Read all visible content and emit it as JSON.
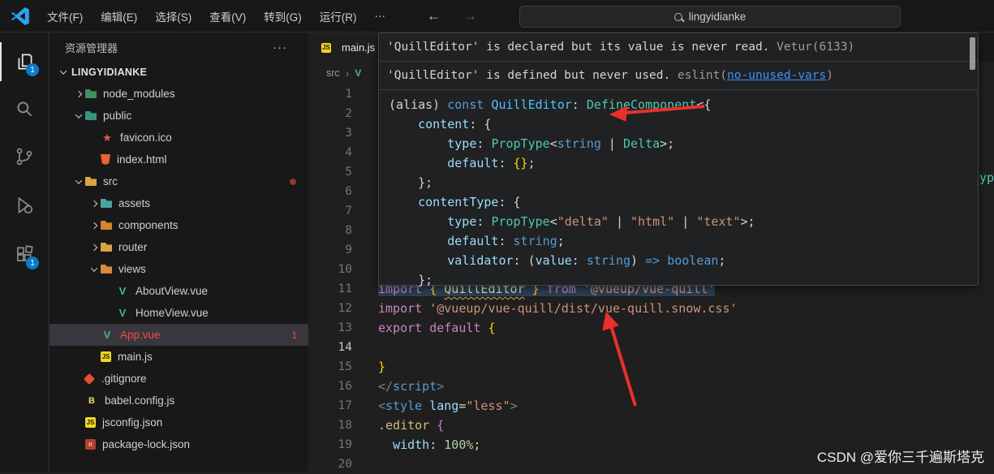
{
  "titlebar": {
    "menus": [
      "文件(F)",
      "编辑(E)",
      "选择(S)",
      "查看(V)",
      "转到(G)",
      "运行(R)"
    ],
    "more": "···",
    "nav_back": "←",
    "nav_forward": "→",
    "search_value": "lingyidianke"
  },
  "activity_bar": {
    "explorer_badge": "1",
    "extensions_badge": "1"
  },
  "sidebar": {
    "header": "资源管理器",
    "items": [
      {
        "label": "LINGYIDIANKE",
        "level": 0,
        "arrow": "v",
        "bold": true
      },
      {
        "label": "node_modules",
        "level": 1,
        "arrow": ">",
        "icon": "folder-nm"
      },
      {
        "label": "public",
        "level": 1,
        "arrow": "v",
        "icon": "folder-public"
      },
      {
        "label": "favicon.ico",
        "level": 2,
        "icon": "favicon"
      },
      {
        "label": "index.html",
        "level": 2,
        "icon": "html"
      },
      {
        "label": "src",
        "level": 1,
        "arrow": "v",
        "icon": "folder-src",
        "dot": true
      },
      {
        "label": "assets",
        "level": 2,
        "arrow": ">",
        "icon": "folder-assets"
      },
      {
        "label": "components",
        "level": 2,
        "arrow": ">",
        "icon": "folder-components"
      },
      {
        "label": "router",
        "level": 2,
        "arrow": ">",
        "icon": "folder-router"
      },
      {
        "label": "views",
        "level": 2,
        "arrow": "v",
        "icon": "folder-views"
      },
      {
        "label": "AboutView.vue",
        "level": 3,
        "icon": "vue"
      },
      {
        "label": "HomeView.vue",
        "level": 3,
        "icon": "vue"
      },
      {
        "label": "App.vue",
        "level": 2,
        "icon": "vue",
        "selected": true,
        "error": true,
        "badge": "1"
      },
      {
        "label": "main.js",
        "level": 2,
        "icon": "js"
      },
      {
        "label": ".gitignore",
        "level": 1,
        "icon": "git"
      },
      {
        "label": "babel.config.js",
        "level": 1,
        "icon": "babel"
      },
      {
        "label": "jsconfig.json",
        "level": 1,
        "icon": "js"
      },
      {
        "label": "package-lock.json",
        "level": 1,
        "icon": "npm"
      }
    ]
  },
  "icons": {
    "js": "JS",
    "vue": "V",
    "babel": "B",
    "npm": "n",
    "favicon": "★"
  },
  "editor": {
    "tab_label": "main.js",
    "breadcrumb_root": "src",
    "breadcrumb_sep": "›",
    "lines": [
      {
        "n": 1
      },
      {
        "n": 2
      },
      {
        "n": 3
      },
      {
        "n": 4
      },
      {
        "n": 5
      },
      {
        "n": 6
      },
      {
        "n": 7
      },
      {
        "n": 8
      },
      {
        "n": 9
      },
      {
        "n": 10
      },
      {
        "n": 11,
        "bg": true,
        "tokens": [
          {
            "t": "import",
            "c": "kw"
          },
          {
            "t": " ",
            "c": "p"
          },
          {
            "t": "{ ",
            "c": "y"
          },
          {
            "t": "QuillEditor",
            "c": "warn"
          },
          {
            "t": " }",
            "c": "y"
          },
          {
            "t": " ",
            "c": "p"
          },
          {
            "t": "from",
            "c": "kw"
          },
          {
            "t": " ",
            "c": "p"
          },
          {
            "t": "'@vueup/vue-quill'",
            "c": "str"
          }
        ]
      },
      {
        "n": 12,
        "tokens": [
          {
            "t": "import",
            "c": "kw"
          },
          {
            "t": " ",
            "c": "p"
          },
          {
            "t": "'@vueup/vue-quill/dist/vue-quill.snow.css'",
            "c": "str"
          }
        ]
      },
      {
        "n": 13,
        "tokens": [
          {
            "t": "export",
            "c": "kw"
          },
          {
            "t": " ",
            "c": "p"
          },
          {
            "t": "default",
            "c": "kw"
          },
          {
            "t": " ",
            "c": "p"
          },
          {
            "t": "{",
            "c": "y"
          }
        ]
      },
      {
        "n": 14,
        "active": true
      },
      {
        "n": 15,
        "tokens": [
          {
            "t": "}",
            "c": "y"
          }
        ]
      },
      {
        "n": 16,
        "tokens": [
          {
            "t": "</",
            "c": "gray"
          },
          {
            "t": "script",
            "c": "blue"
          },
          {
            "t": ">",
            "c": "gray"
          }
        ]
      },
      {
        "n": 17,
        "tokens": [
          {
            "t": "<",
            "c": "gray"
          },
          {
            "t": "style",
            "c": "blue"
          },
          {
            "t": " ",
            "c": "p"
          },
          {
            "t": "lang",
            "c": "var"
          },
          {
            "t": "=",
            "c": "p"
          },
          {
            "t": "\"less\"",
            "c": "str"
          },
          {
            "t": ">",
            "c": "gray"
          }
        ]
      },
      {
        "n": 18,
        "tokens": [
          {
            "t": ".editor",
            "c": "css"
          },
          {
            "t": " ",
            "c": "p"
          },
          {
            "t": "{",
            "c": "m"
          }
        ]
      },
      {
        "n": 19,
        "tokens": [
          {
            "t": "  ",
            "c": "p"
          },
          {
            "t": "width",
            "c": "var"
          },
          {
            "t": ": ",
            "c": "p"
          },
          {
            "t": "100%",
            "c": "num"
          },
          {
            "t": ";",
            "c": "p"
          }
        ]
      },
      {
        "n": 20
      }
    ]
  },
  "hover": {
    "messages": [
      {
        "parts": [
          {
            "t": "'QuillEditor' is declared but its value is never read. ",
            "c": "msg"
          },
          {
            "t": "Vetur(6133)",
            "c": "dim"
          }
        ]
      },
      {
        "parts": [
          {
            "t": "'QuillEditor' is defined but never used. ",
            "c": "msg"
          },
          {
            "t": "eslint(",
            "c": "dim"
          },
          {
            "t": "no-unused-vars",
            "c": "link"
          },
          {
            "t": ")",
            "c": "dim"
          }
        ]
      }
    ],
    "code": [
      {
        "tokens": [
          {
            "t": "(alias) ",
            "c": "p"
          },
          {
            "t": "const ",
            "c": "blue"
          },
          {
            "t": "QuillEditor",
            "c": "varb"
          },
          {
            "t": ": ",
            "c": "p"
          },
          {
            "t": "DefineComponent",
            "c": "type"
          },
          {
            "t": "<{",
            "c": "p"
          }
        ]
      },
      {
        "tokens": [
          {
            "t": "    ",
            "c": "p"
          },
          {
            "t": "content",
            "c": "var"
          },
          {
            "t": ": {",
            "c": "p"
          }
        ]
      },
      {
        "tokens": [
          {
            "t": "        ",
            "c": "p"
          },
          {
            "t": "type",
            "c": "var"
          },
          {
            "t": ": ",
            "c": "p"
          },
          {
            "t": "PropType",
            "c": "type"
          },
          {
            "t": "<",
            "c": "p"
          },
          {
            "t": "string",
            "c": "blue"
          },
          {
            "t": " | ",
            "c": "p"
          },
          {
            "t": "Delta",
            "c": "type"
          },
          {
            "t": ">;",
            "c": "p"
          }
        ]
      },
      {
        "tokens": [
          {
            "t": "        ",
            "c": "p"
          },
          {
            "t": "default",
            "c": "var"
          },
          {
            "t": ": ",
            "c": "p"
          },
          {
            "t": "{}",
            "c": "y"
          },
          {
            "t": ";",
            "c": "p"
          }
        ]
      },
      {
        "tokens": [
          {
            "t": "    };",
            "c": "p"
          }
        ]
      },
      {
        "tokens": [
          {
            "t": "    ",
            "c": "p"
          },
          {
            "t": "contentType",
            "c": "var"
          },
          {
            "t": ": {",
            "c": "p"
          }
        ]
      },
      {
        "tokens": [
          {
            "t": "        ",
            "c": "p"
          },
          {
            "t": "type",
            "c": "var"
          },
          {
            "t": ": ",
            "c": "p"
          },
          {
            "t": "PropType",
            "c": "type"
          },
          {
            "t": "<",
            "c": "p"
          },
          {
            "t": "\"delta\"",
            "c": "str"
          },
          {
            "t": " | ",
            "c": "p"
          },
          {
            "t": "\"html\"",
            "c": "str"
          },
          {
            "t": " | ",
            "c": "p"
          },
          {
            "t": "\"text\"",
            "c": "str"
          },
          {
            "t": ">;",
            "c": "p"
          }
        ]
      },
      {
        "tokens": [
          {
            "t": "        ",
            "c": "p"
          },
          {
            "t": "default",
            "c": "var"
          },
          {
            "t": ": ",
            "c": "p"
          },
          {
            "t": "string",
            "c": "blue"
          },
          {
            "t": ";",
            "c": "p"
          }
        ]
      },
      {
        "tokens": [
          {
            "t": "        ",
            "c": "p"
          },
          {
            "t": "validator",
            "c": "var"
          },
          {
            "t": ": (",
            "c": "p"
          },
          {
            "t": "value",
            "c": "var"
          },
          {
            "t": ": ",
            "c": "p"
          },
          {
            "t": "string",
            "c": "blue"
          },
          {
            "t": ") ",
            "c": "p"
          },
          {
            "t": "=>",
            "c": "blue"
          },
          {
            "t": " ",
            "c": "p"
          },
          {
            "t": "boolean",
            "c": "blue"
          },
          {
            "t": ";",
            "c": "p"
          }
        ]
      },
      {
        "tokens": [
          {
            "t": "    };",
            "c": "p"
          }
        ]
      }
    ]
  },
  "fragment": {
    "text": "yp"
  },
  "watermark": "CSDN @爱你三千遍斯塔克",
  "colors": {
    "annotation_red": "#e8312a",
    "error_red": "#f14c4c",
    "badge_blue": "#0a7acc",
    "accent_blue": "#2aa3f0"
  }
}
